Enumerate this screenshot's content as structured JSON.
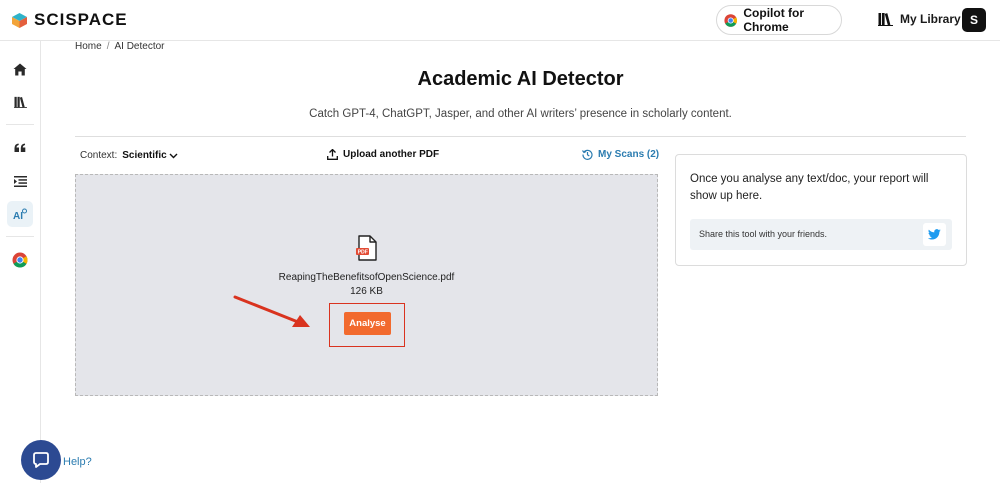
{
  "header": {
    "logo_text": "SCISPACE",
    "copilot_label": "Copilot for Chrome",
    "library_label": "My Library",
    "avatar_initial": "S"
  },
  "sidebar": {
    "items": [
      {
        "icon": "home-icon"
      },
      {
        "icon": "library-icon"
      },
      {
        "icon": "quote-icon"
      },
      {
        "icon": "list-indent-icon"
      },
      {
        "icon": "ai-detector-icon",
        "active": true
      },
      {
        "icon": "chrome-icon"
      }
    ]
  },
  "breadcrumb": {
    "home": "Home",
    "separator": "/",
    "current": "AI Detector"
  },
  "main": {
    "title": "Academic AI Detector",
    "subtitle": "Catch GPT-4, ChatGPT, Jasper, and other AI writers’ presence in scholarly content.",
    "context_label": "Context:",
    "context_value": "Scientific",
    "upload_label": "Upload another PDF",
    "myscans_label": "My Scans (2)",
    "file": {
      "name": "ReapingTheBenefitsofOpenScience.pdf",
      "size": "126 KB",
      "icon_badge": "PDF"
    },
    "analyse_label": "Analyse"
  },
  "report": {
    "text": "Once you analyse any text/doc, your report will show up here.",
    "share_text": "Share this tool with your friends."
  },
  "help": {
    "label": "Help?"
  },
  "colors": {
    "accent_orange": "#f26a2e",
    "link_blue": "#2b7cb0",
    "annotation_red": "#d9331f",
    "chat_blue": "#2c4a92"
  }
}
